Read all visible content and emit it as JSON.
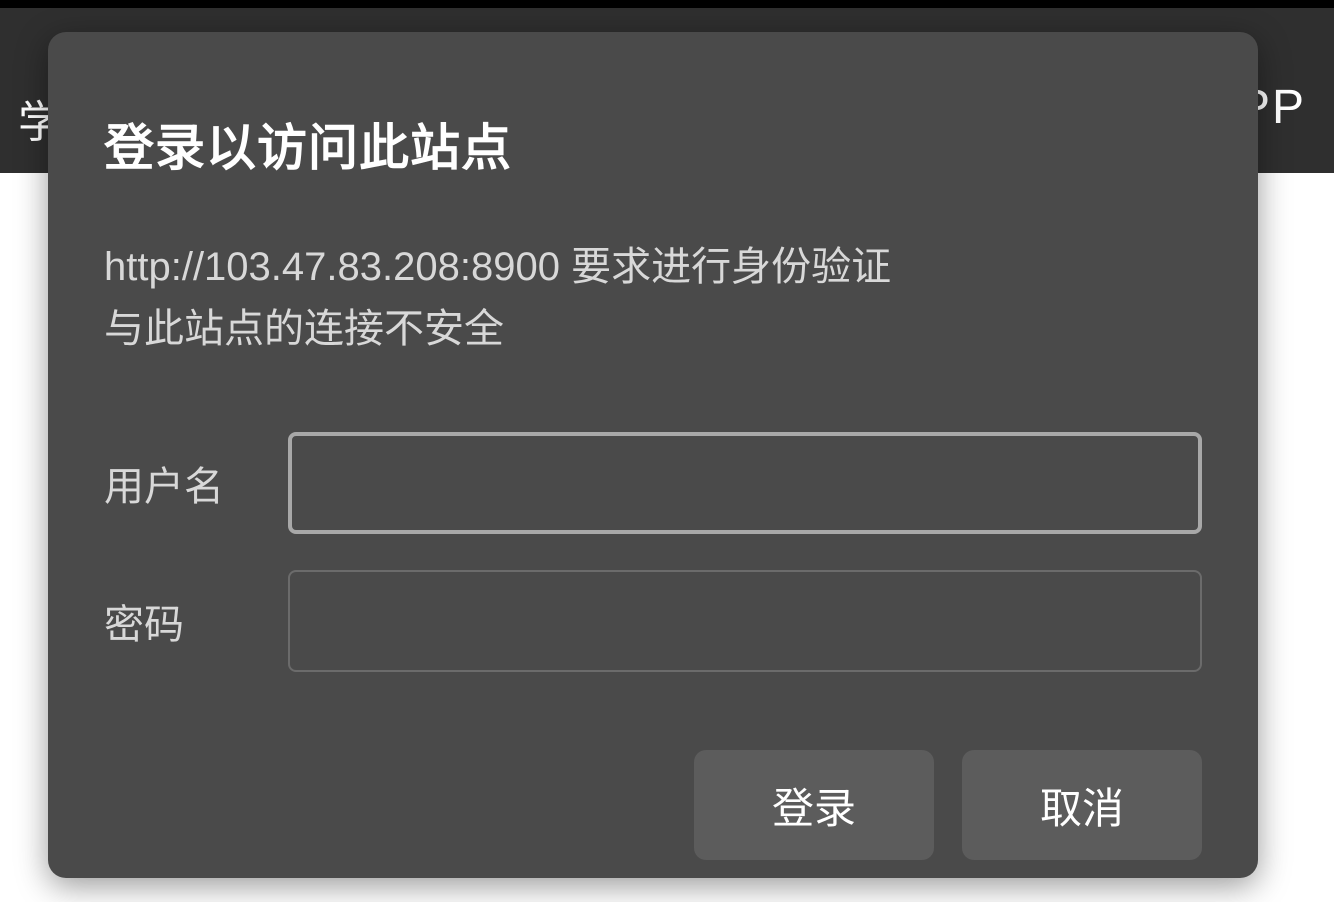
{
  "header": {
    "left_fragment": "学",
    "right_fragment": "PP"
  },
  "dialog": {
    "title": "登录以访问此站点",
    "message_line1": "http://103.47.83.208:8900 要求进行身份验证",
    "message_line2": "与此站点的连接不安全",
    "username_label": "用户名",
    "password_label": "密码",
    "username_value": "",
    "password_value": "",
    "login_button": "登录",
    "cancel_button": "取消"
  }
}
